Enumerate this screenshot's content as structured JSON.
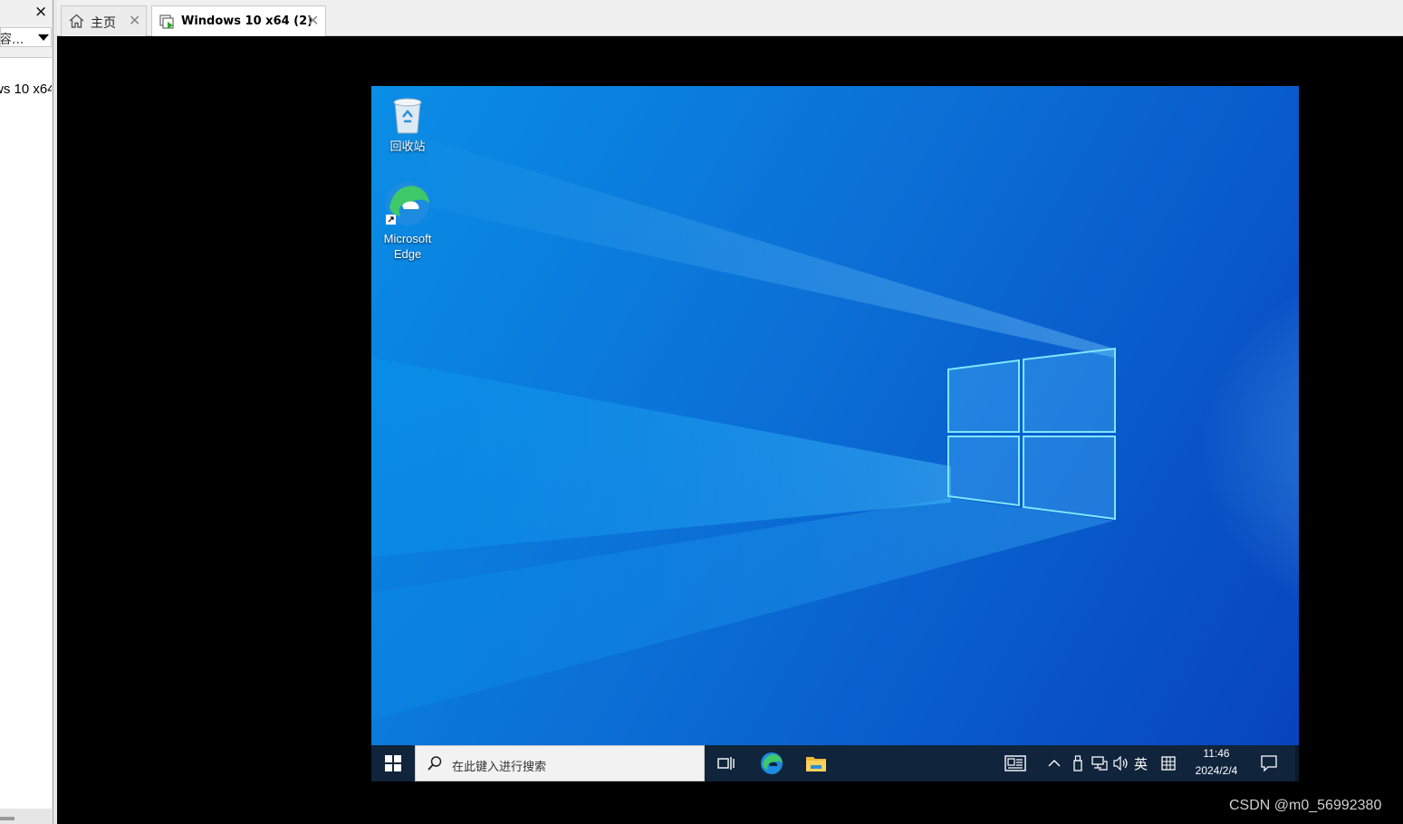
{
  "left_panel": {
    "close_label": "×",
    "search_text": "容...",
    "tree_item": "ws 10 x64"
  },
  "tabs": [
    {
      "label": "主页",
      "icon": "home-icon"
    },
    {
      "label": "Windows 10 x64 (2)",
      "icon": "vm-running-icon"
    }
  ],
  "desktop": {
    "icons": [
      {
        "label": "回收站",
        "icon": "recycle-bin-icon"
      },
      {
        "label_line1": "Microsoft",
        "label_line2": "Edge",
        "icon": "edge-icon"
      }
    ]
  },
  "taskbar": {
    "search_placeholder": "在此键入进行搜索",
    "ime_label": "英",
    "clock": {
      "time": "11:46",
      "date": "2024/2/4"
    },
    "apps": [
      "task-view-icon",
      "edge-icon",
      "file-explorer-icon"
    ],
    "tray": [
      "news-icon",
      "chevron-up-icon",
      "usb-icon",
      "network-icon",
      "volume-icon",
      "ime-icon",
      "ime-mode-icon",
      "notification-icon"
    ]
  },
  "watermark": "CSDN @m0_56992380",
  "colors": {
    "desktop_blue": "#0b6fd6",
    "taskbar": "#10243c",
    "vm_background": "#000000"
  }
}
